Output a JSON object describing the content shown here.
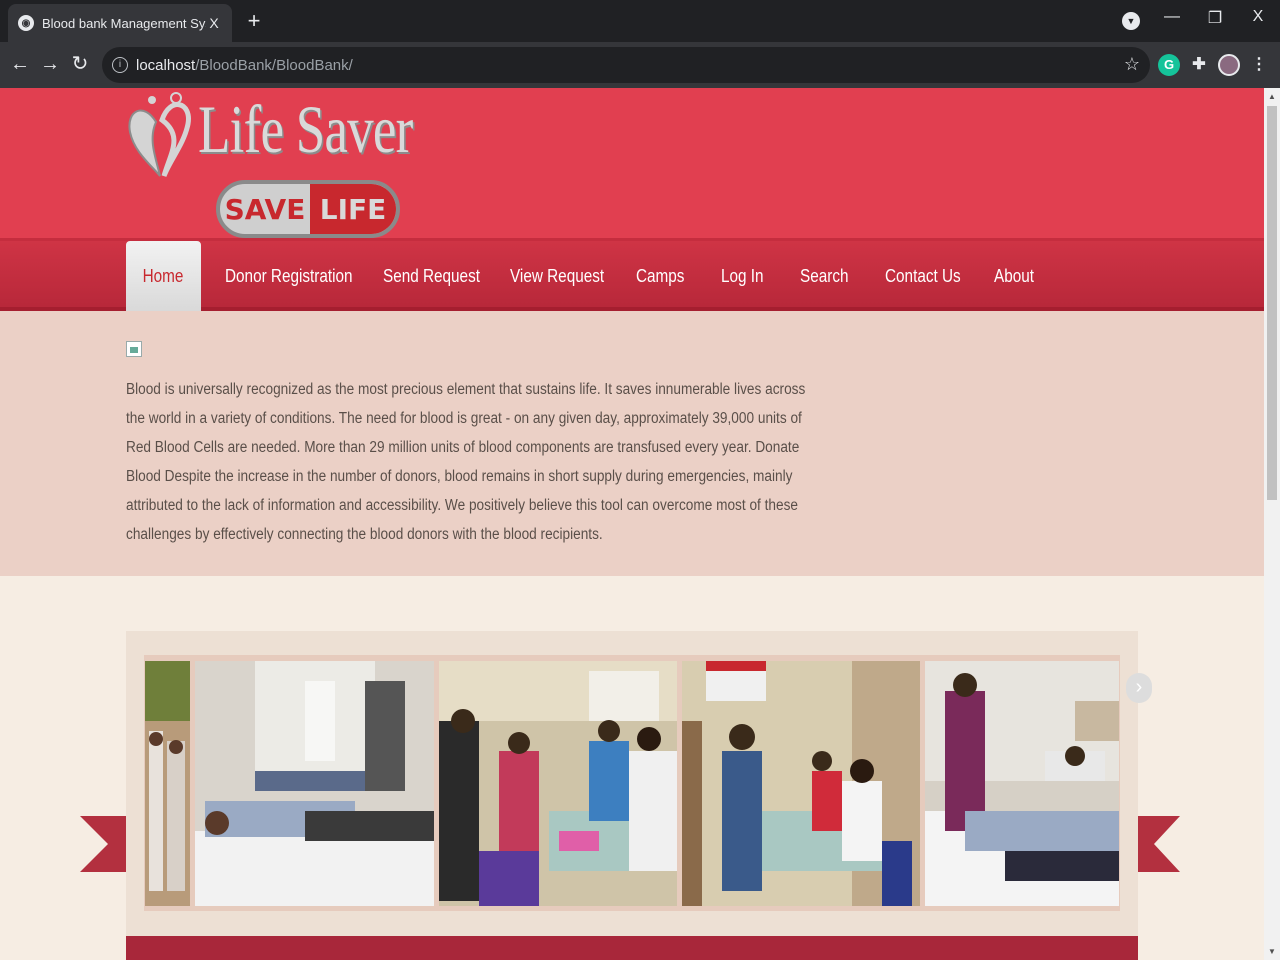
{
  "browser": {
    "tab_title": "Blood bank Management System",
    "tab_close": "X",
    "new_tab": "+",
    "url_host": "localhost",
    "url_path": "/BloodBank/BloodBank/",
    "window_close": "X"
  },
  "site": {
    "logo_text": "Life Saver",
    "logo_save": "SAVE",
    "logo_life": "LIFE"
  },
  "nav": {
    "items": [
      "Home",
      "Donor Registration",
      "Send Request",
      "View Request",
      "Camps",
      "Log In",
      "Search",
      "Contact Us",
      "About"
    ],
    "active": "Home"
  },
  "intro": {
    "text": "Blood is universally recognized as the most precious element that sustains life. It saves innumerable lives across the world in a variety of conditions. The need for blood is great - on any given day, approximately 39,000 units of Red Blood Cells are needed. More than 29 million units of blood components are transfused every year. Donate Blood Despite the increase in the number of donors, blood remains in short supply during emergencies, mainly attributed to the lack of information and accessibility. We positively believe this tool can overcome most of these challenges by effectively connecting the blood donors with the blood recipients."
  },
  "colors": {
    "header_red": "#e13f50",
    "nav_red": "#b8283a",
    "intro_bg": "#ebd0c6",
    "page_bg": "#f6ede3"
  },
  "icons": [
    "globe-icon",
    "back-icon",
    "forward-icon",
    "reload-icon",
    "info-icon",
    "star-icon",
    "grammarly-icon",
    "extensions-icon",
    "avatar",
    "menu-icon",
    "chevron-right-icon"
  ]
}
